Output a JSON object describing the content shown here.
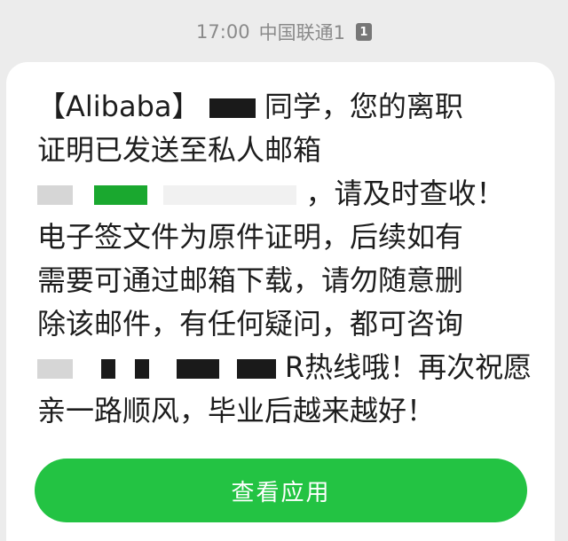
{
  "status": {
    "time": "17:00",
    "carrier": "中国联通1",
    "sim_badge": "1"
  },
  "message": {
    "line1_prefix": "【Alibaba】",
    "line1_suffix": "同学，您的离职",
    "line2": "证明已发送至私人邮箱",
    "line3_suffix": "，请及时查收！",
    "line4": "电子签文件为原件证明，后续如有",
    "line5": "需要可通过邮箱下载，请勿随意删",
    "line6": "除该邮件，有任何疑问，都可咨询",
    "line7_suffix": "R热线哦！再次祝愿",
    "line8": "亲一路顺风，毕业后越来越好！"
  },
  "actions": {
    "open_app_label": "查看应用"
  },
  "colors": {
    "accent": "#23c343",
    "background": "#ececec",
    "card": "#ffffff"
  }
}
